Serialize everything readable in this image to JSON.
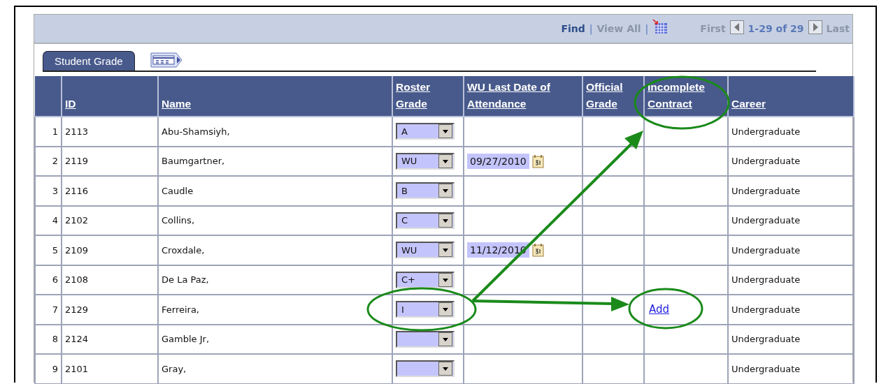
{
  "toolbar": [
    {
      "kind": "link",
      "label": "Find",
      "disabled": false
    },
    {
      "kind": "separator",
      "label": "|"
    },
    {
      "kind": "link",
      "label": "View All",
      "disabled": true
    },
    {
      "kind": "separator",
      "label": "|"
    },
    {
      "kind": "grid"
    },
    {
      "kind": "link",
      "label": "First",
      "disabled": true
    },
    {
      "kind": "prev"
    },
    {
      "kind": "range",
      "label": "1-29 of 29"
    },
    {
      "kind": "next"
    },
    {
      "kind": "link",
      "label": "Last",
      "disabled": true
    }
  ],
  "tabs": [
    {
      "label": "Student Grade",
      "selected": true
    }
  ],
  "table": {
    "columns": [
      "ID",
      "Name",
      "Roster Grade",
      "WU Last Date of Attendance",
      "Official Grade",
      "Incomplete Contract",
      "Career"
    ],
    "rows": [
      {
        "number": "1",
        "id": "2113",
        "name": "Abu-Shamsiyh,",
        "grade": "A",
        "career": "Undergraduate"
      },
      {
        "number": "2",
        "id": "2119",
        "name": "Baumgartner,",
        "grade": "WU",
        "wu_date": "09/27/2010",
        "career": "Undergraduate"
      },
      {
        "number": "3",
        "id": "2116",
        "name": "Caudle",
        "grade": "B",
        "career": "Undergraduate"
      },
      {
        "number": "4",
        "id": "2102",
        "name": "Collins,",
        "grade": "C",
        "career": "Undergraduate"
      },
      {
        "number": "5",
        "id": "2109",
        "name": "Croxdale,",
        "grade": "WU",
        "wu_date": "11/12/2010",
        "career": "Undergraduate"
      },
      {
        "number": "6",
        "id": "2108",
        "name": "De La Paz,",
        "grade": "C+",
        "career": "Undergraduate"
      },
      {
        "number": "7",
        "id": "2129",
        "name": "Ferreira,",
        "grade": "I",
        "incomplete_link": "Add",
        "career": "Undergraduate"
      },
      {
        "number": "8",
        "id": "2124",
        "name": "Gamble Jr,",
        "career": "Undergraduate"
      },
      {
        "number": "9",
        "id": "2101",
        "name": "Gray,",
        "career": "Undergraduate"
      }
    ]
  }
}
